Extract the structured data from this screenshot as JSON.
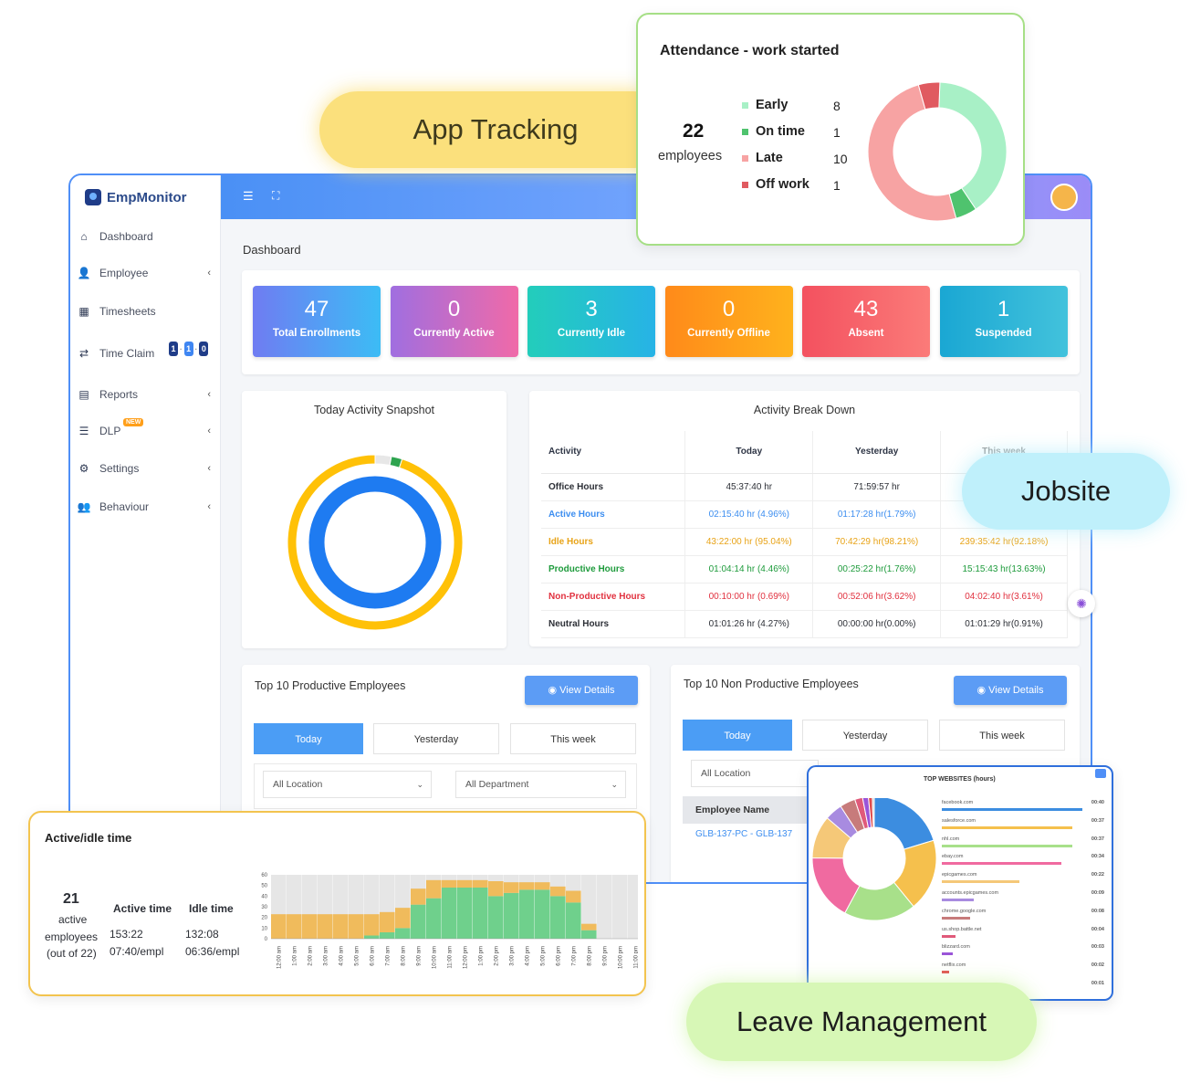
{
  "app": {
    "brand": "EmpMonitor"
  },
  "sidebar": {
    "items": [
      {
        "label": "Dashboard",
        "icon": "home-icon",
        "glyph": "⌂",
        "chevron": false
      },
      {
        "label": "Employee",
        "icon": "employee-icon",
        "glyph": "👤",
        "chevron": true
      },
      {
        "label": "Timesheets",
        "icon": "calendar-icon",
        "glyph": "▦",
        "chevron": false
      },
      {
        "label": "Time Claim",
        "icon": "swap-icon",
        "glyph": "⇄",
        "chevron": false
      },
      {
        "label": "Reports",
        "icon": "report-icon",
        "glyph": "▤",
        "chevron": true
      },
      {
        "label": "DLP",
        "icon": "dlp-icon",
        "glyph": "☰",
        "chevron": true
      },
      {
        "label": "Settings",
        "icon": "gear-icon",
        "glyph": "⚙",
        "chevron": true
      },
      {
        "label": "Behaviour",
        "icon": "users-icon",
        "glyph": "👥",
        "chevron": true
      }
    ],
    "dlp_badge": "NEW",
    "time_claim_counts": [
      "1",
      "1",
      "0"
    ],
    "time_claim_colors": [
      "#1f3c88",
      "#3f86f2",
      "#1f3c88"
    ]
  },
  "page": {
    "title": "Dashboard"
  },
  "stats": [
    {
      "value": "47",
      "label": "Total Enrollments",
      "color": "linear-gradient(90deg,#6f7cf2,#3cbcf5)"
    },
    {
      "value": "0",
      "label": "Currently Active",
      "color": "linear-gradient(90deg,#a06ee0,#f06aa8)"
    },
    {
      "value": "3",
      "label": "Currently Idle",
      "color": "linear-gradient(90deg,#23cdbb,#27b3e6)"
    },
    {
      "value": "0",
      "label": "Currently Offline",
      "color": "linear-gradient(90deg,#ff8a1a,#ffb21c)"
    },
    {
      "value": "43",
      "label": "Absent",
      "color": "linear-gradient(90deg,#f3515f,#fb7b79)"
    },
    {
      "value": "1",
      "label": "Suspended",
      "color": "linear-gradient(90deg,#1aa7d3,#42c2dc)"
    }
  ],
  "snapshot": {
    "title": "Today Activity Snapshot",
    "outer_colors": [
      "#e7e7e7",
      "#2ea44f",
      "#ffc107"
    ],
    "outer_values": [
      3,
      2,
      95
    ],
    "inner_color": "#1e7bf1"
  },
  "breakdown": {
    "title": "Activity Break Down",
    "headers": [
      "Activity",
      "Today",
      "Yesterday",
      "This week"
    ],
    "rows": [
      {
        "label": "Office Hours",
        "color": "#2c2f36",
        "today": "45:37:40 hr",
        "yesterday": "71:59:57 hr",
        "week": ""
      },
      {
        "label": "Active Hours",
        "color": "#3d8ef0",
        "today": "02:15:40 hr (4.96%)",
        "yesterday": "01:17:28 hr(1.79%)",
        "week": "2("
      },
      {
        "label": "Idle Hours",
        "color": "#e8a317",
        "today": "43:22:00 hr (95.04%)",
        "yesterday": "70:42:29 hr(98.21%)",
        "week": "239:35:42 hr(92.18%)"
      },
      {
        "label": "Productive Hours",
        "color": "#1e9b3c",
        "today": "01:04:14 hr (4.46%)",
        "yesterday": "00:25:22 hr(1.76%)",
        "week": "15:15:43 hr(13.63%)"
      },
      {
        "label": "Non-Productive Hours",
        "color": "#e1313f",
        "today": "00:10:00 hr (0.69%)",
        "yesterday": "00:52:06 hr(3.62%)",
        "week": "04:02:40 hr(3.61%)"
      },
      {
        "label": "Neutral Hours",
        "color": "#2c2f36",
        "today": "01:01:26 hr (4.27%)",
        "yesterday": "00:00:00 hr(0.00%)",
        "week": "01:01:29 hr(0.91%)"
      }
    ]
  },
  "top10": {
    "title": "Top 10 Productive Employees",
    "view_label": "View Details",
    "tabs": [
      "Today",
      "Yesterday",
      "This week"
    ],
    "location": "All Location",
    "department": "All Department"
  },
  "nontop10": {
    "title": "Top 10 Non Productive Employees",
    "view_label": "View Details",
    "tabs": [
      "Today",
      "Yesterday",
      "This week"
    ],
    "location": "All Location",
    "col_header": "Employee Name",
    "row1": "GLB-137-PC - GLB-137"
  },
  "attendance": {
    "title": "Attendance - work started",
    "total": "22",
    "total_label": "employees",
    "items": [
      {
        "label": "Early",
        "value": "8",
        "color": "#a8f0c6"
      },
      {
        "label": "On time",
        "value": "1",
        "color": "#4fc36e"
      },
      {
        "label": "Late",
        "value": "10",
        "color": "#f7a3a3"
      },
      {
        "label": "Off work",
        "value": "1",
        "color": "#e05a60"
      }
    ]
  },
  "active_idle": {
    "title": "Active/idle time",
    "count": "21",
    "count_label_1": "active",
    "count_label_2": "employees",
    "count_label_3": "(out of 22)",
    "active_header": "Active time",
    "idle_header": "Idle time",
    "active_total": "153:22",
    "idle_total": "132:08",
    "active_avg": "07:40/empl",
    "idle_avg": "06:36/empl"
  },
  "chart_data": {
    "type": "bar",
    "categories": [
      "12:00 am",
      "1:00 am",
      "2:00 am",
      "3:00 am",
      "4:00 am",
      "5:00 am",
      "6:00 am",
      "7:00 am",
      "8:00 am",
      "9:00 am",
      "10:00 am",
      "11:00 am",
      "12:00 pm",
      "1:00 pm",
      "2:00 pm",
      "3:00 pm",
      "4:00 pm",
      "5:00 pm",
      "6:00 pm",
      "7:00 pm",
      "8:00 pm",
      "9:00 pm",
      "10:00 pm",
      "11:00 pm"
    ],
    "series": [
      {
        "name": "Active",
        "color": "#6fd08c",
        "values": [
          0,
          0,
          0,
          0,
          0,
          0,
          3,
          6,
          10,
          32,
          38,
          48,
          48,
          48,
          40,
          43,
          46,
          46,
          40,
          34,
          8,
          0,
          0,
          0
        ]
      },
      {
        "name": "Idle",
        "color": "#f0bb5c",
        "values": [
          23,
          23,
          23,
          23,
          23,
          23,
          20,
          19,
          19,
          15,
          17,
          7,
          7,
          7,
          14,
          10,
          7,
          7,
          9,
          11,
          6,
          0,
          0,
          0
        ]
      }
    ],
    "background_color": "#e6e6e6",
    "ylim": [
      0,
      60
    ],
    "yticks": [
      0,
      10,
      20,
      30,
      40,
      50,
      60
    ]
  },
  "websites": {
    "title": "TOP WEBSITES (hours)",
    "items": [
      {
        "name": "facebook.com",
        "time": "00:40",
        "color": "#3c8de0",
        "frac": 1.0
      },
      {
        "name": "salesforce.com",
        "time": "00:37",
        "color": "#f5c04d",
        "frac": 0.93
      },
      {
        "name": "nhl.com",
        "time": "00:37",
        "color": "#a8e08a",
        "frac": 0.93
      },
      {
        "name": "ebay.com",
        "time": "00:34",
        "color": "#f06aa0",
        "frac": 0.85
      },
      {
        "name": "epicgames.com",
        "time": "00:22",
        "color": "#f5c878",
        "frac": 0.55
      },
      {
        "name": "accounts.epicgames.com",
        "time": "00:09",
        "color": "#a88be0",
        "frac": 0.23
      },
      {
        "name": "chrome.google.com",
        "time": "00:08",
        "color": "#c77b7b",
        "frac": 0.2
      },
      {
        "name": "us.shop.battle.net",
        "time": "00:04",
        "color": "#e05a7a",
        "frac": 0.1
      },
      {
        "name": "blizzard.com",
        "time": "00:03",
        "color": "#9a55d8",
        "frac": 0.08
      },
      {
        "name": "netflix.com",
        "time": "00:02",
        "color": "#e04a4a",
        "frac": 0.05
      },
      {
        "name": "",
        "time": "00:01",
        "color": "#cccccc",
        "frac": 0.0
      }
    ],
    "donut": [
      40,
      37,
      37,
      34,
      22,
      9,
      8,
      4,
      3,
      2,
      1
    ]
  },
  "pills": {
    "app_tracking": "App Tracking",
    "jobsite": "Jobsite",
    "leave": "Leave Management"
  }
}
